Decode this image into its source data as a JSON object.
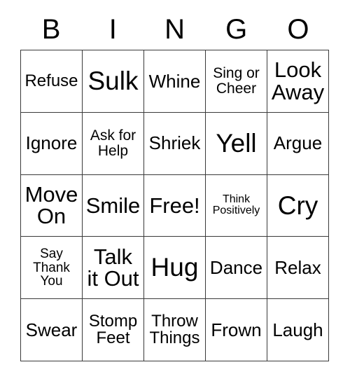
{
  "card": {
    "header_letters": [
      "B",
      "I",
      "N",
      "G",
      "O"
    ],
    "rows": [
      [
        {
          "text": "Refuse",
          "size": "sm"
        },
        {
          "text": "Sulk",
          "size": "xl"
        },
        {
          "text": "Whine",
          "size": "md"
        },
        {
          "text": "Sing or\nCheer",
          "size": "xs"
        },
        {
          "text": "Look\nAway",
          "size": "lg"
        }
      ],
      [
        {
          "text": "Ignore",
          "size": "md"
        },
        {
          "text": "Ask for\nHelp",
          "size": "xs"
        },
        {
          "text": "Shriek",
          "size": "md"
        },
        {
          "text": "Yell",
          "size": "xl"
        },
        {
          "text": "Argue",
          "size": "md"
        }
      ],
      [
        {
          "text": "Move\nOn",
          "size": "lg"
        },
        {
          "text": "Smile",
          "size": "lg"
        },
        {
          "text": "Free!",
          "size": "lg"
        },
        {
          "text": "Think\nPositively",
          "size": "tiny"
        },
        {
          "text": "Cry",
          "size": "xl"
        }
      ],
      [
        {
          "text": "Say\nThank\nYou",
          "size": "xxs"
        },
        {
          "text": "Talk\nit Out",
          "size": "lg"
        },
        {
          "text": "Hug",
          "size": "xl"
        },
        {
          "text": "Dance",
          "size": "md"
        },
        {
          "text": "Relax",
          "size": "md"
        }
      ],
      [
        {
          "text": "Swear",
          "size": "md"
        },
        {
          "text": "Stomp\nFeet",
          "size": "sm"
        },
        {
          "text": "Throw\nThings",
          "size": "sm"
        },
        {
          "text": "Frown",
          "size": "md"
        },
        {
          "text": "Laugh",
          "size": "md"
        }
      ]
    ],
    "colors": {
      "background": "#ffffff",
      "text": "#000000",
      "border": "#3a3a3a"
    }
  }
}
